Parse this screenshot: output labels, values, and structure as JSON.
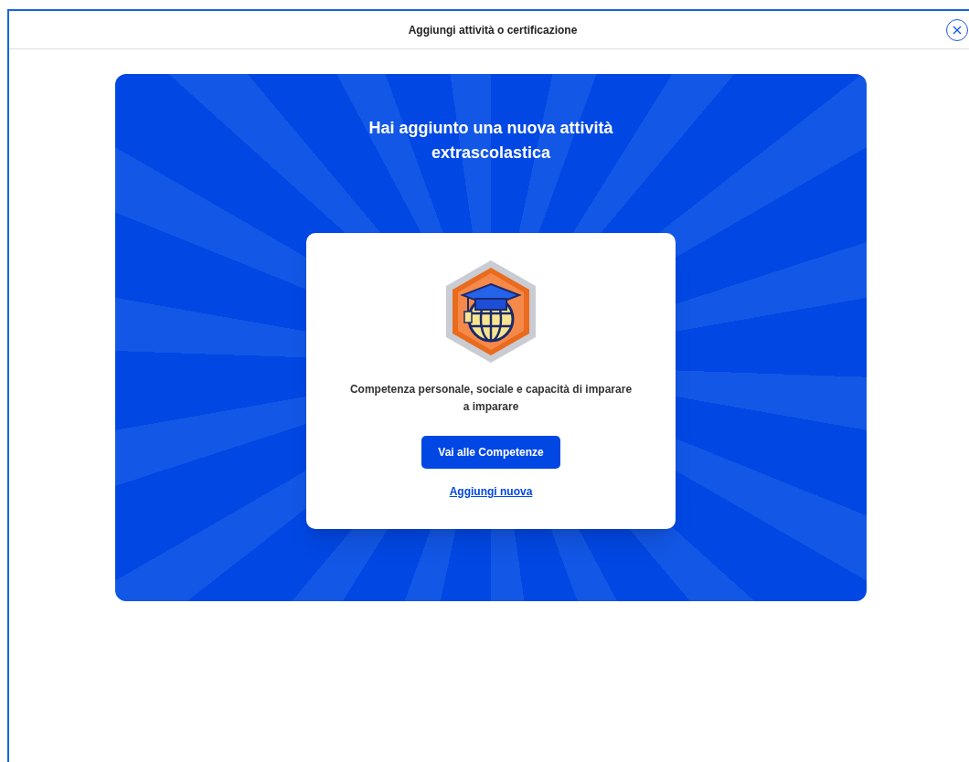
{
  "dialog": {
    "title": "Aggiungi attività o certificazione"
  },
  "banner": {
    "heading": "Hai aggiunto una nuova attività extrascolastica",
    "card": {
      "competence": "Competenza personale, sociale e capacità di imparare a imparare",
      "primary_button": "Vai alle Competenze",
      "link": "Aggiungi nuova"
    }
  }
}
